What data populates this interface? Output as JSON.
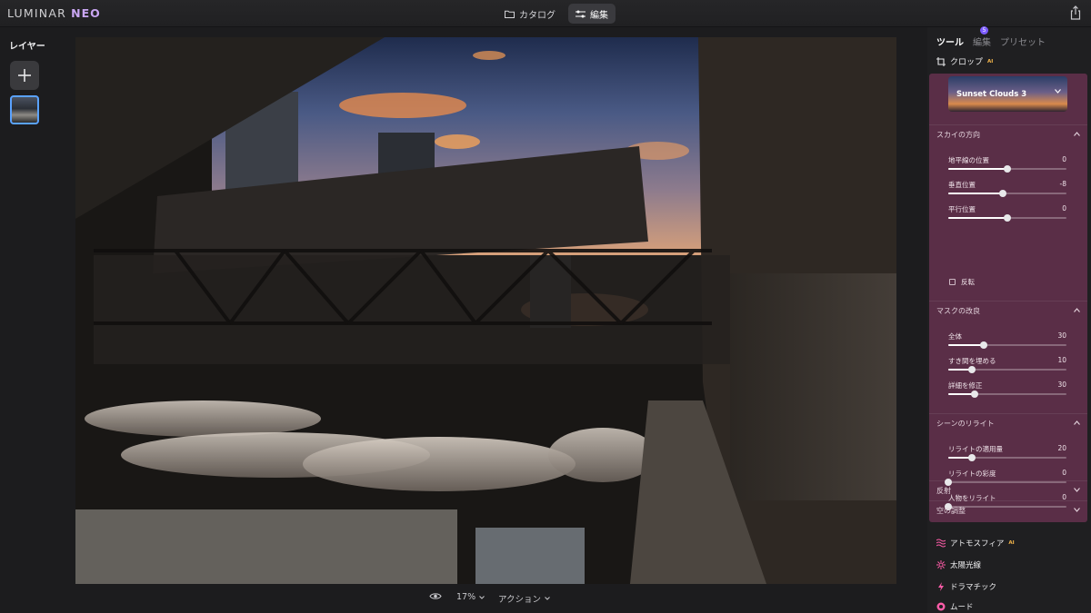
{
  "app": {
    "logo_main": "LUMINAR",
    "logo_sub": "NEO"
  },
  "topnav": {
    "catalog": "カタログ",
    "edit": "編集"
  },
  "layers": {
    "title": "レイヤー"
  },
  "bottombar": {
    "zoom": "17%",
    "action": "アクション"
  },
  "rightpanel": {
    "tabs": [
      {
        "label": "ツール"
      },
      {
        "label": "編集",
        "badge": "5"
      },
      {
        "label": "プリセット"
      }
    ],
    "crop": {
      "label": "クロップ",
      "ai": "AI"
    },
    "sky": {
      "selected": "Sunset Clouds 3",
      "sections": {
        "direction": "スカイの方向",
        "mask": "マスクの改良",
        "relight": "シーンのリライト",
        "reflection": "反射",
        "sky_adjust": "空の調整"
      },
      "direction_sliders": [
        {
          "label": "地平線の位置",
          "value": "0",
          "level": 0.5
        },
        {
          "label": "垂直位置",
          "value": "-8",
          "level": 0.46
        },
        {
          "label": "平行位置",
          "value": "0",
          "level": 0.5
        }
      ],
      "flip": "反転",
      "mask_sliders": [
        {
          "label": "全体",
          "value": "30",
          "level": 0.3
        },
        {
          "label": "すき間を埋める",
          "value": "10",
          "level": 0.2
        },
        {
          "label": "詳細を修正",
          "value": "30",
          "level": 0.22
        }
      ],
      "relight_sliders": [
        {
          "label": "リライトの適用量",
          "value": "20",
          "level": 0.2
        },
        {
          "label": "リライトの彩度",
          "value": "0",
          "level": 0.0
        },
        {
          "label": "人物をリライト",
          "value": "0",
          "level": 0.0
        }
      ]
    },
    "tools": [
      {
        "label": "アトモスフィア",
        "ai": "AI",
        "color": "#ff5ca8"
      },
      {
        "label": "太陽光線",
        "color": "#ff5ca8"
      },
      {
        "label": "ドラマチック",
        "color": "#ff5ca8"
      },
      {
        "label": "ムード",
        "color": "#ff5ca8"
      }
    ]
  }
}
